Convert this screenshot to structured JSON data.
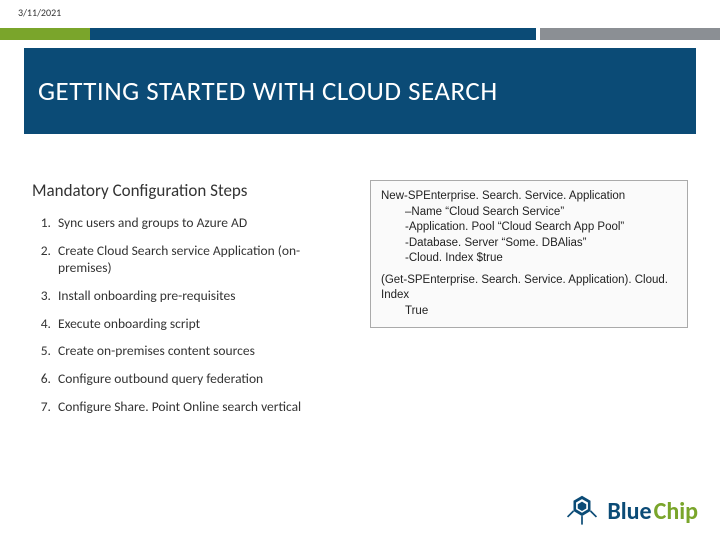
{
  "date": "3/11/2021",
  "title": "GETTING STARTED WITH CLOUD SEARCH",
  "section_heading": "Mandatory Configuration Steps",
  "steps": [
    "Sync users and groups to Azure AD",
    "Create Cloud Search service Application (on-premises)",
    "Install onboarding pre-requisites",
    "Execute onboarding script",
    "Create on-premises content sources",
    "Configure outbound query federation",
    "Configure Share. Point Online search vertical"
  ],
  "code": {
    "block1": {
      "line1": "New-SPEnterprise. Search. Service. Application",
      "line2": "–Name “Cloud Search Service”",
      "line3": "-Application. Pool “Cloud Search App Pool”",
      "line4": "-Database. Server “Some. DBAlias”",
      "line5": "-Cloud. Index $true"
    },
    "block2": {
      "line1": "(Get-SPEnterprise. Search. Service. Application). Cloud. Index",
      "line2": "True"
    }
  },
  "brand": {
    "blue": "Blue",
    "chip": "Chip"
  }
}
